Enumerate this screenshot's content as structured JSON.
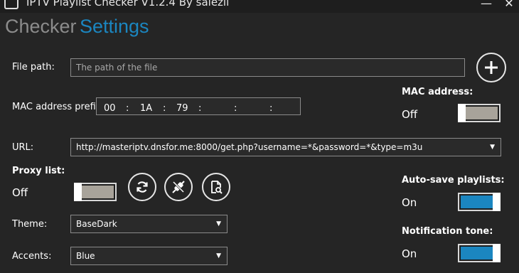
{
  "window": {
    "title": "IPTV Playlist Checker V1.2.4 By salezil",
    "minimize_glyph": "—",
    "close_glyph": "✕"
  },
  "nav": {
    "checker": "Checker",
    "settings": "Settings"
  },
  "colors": {
    "accent": "#1b86c0",
    "toggle_off_fill": "#a8a39a",
    "background": "#252525"
  },
  "file": {
    "label": "File path:",
    "placeholder": "The path of the file",
    "add_icon": "plus-circle-icon"
  },
  "mac_prefix": {
    "label": "MAC address prefix:",
    "segments": [
      "00",
      "1A",
      "79",
      "",
      "",
      ""
    ]
  },
  "mac_address": {
    "label": "MAC address:",
    "state": "Off",
    "on": false
  },
  "url": {
    "label": "URL:",
    "value": "http://masteriptv.dnsfor.me:8000/get.php?username=*&password=*&type=m3u"
  },
  "proxy": {
    "label": "Proxy list:",
    "state": "Off",
    "on": false,
    "buttons": [
      "refresh-icon",
      "unplug-icon",
      "file-search-icon"
    ]
  },
  "autosave": {
    "label": "Auto-save playlists:",
    "state": "On",
    "on": true
  },
  "notification": {
    "label": "Notification tone:",
    "state": "On",
    "on": true
  },
  "theme": {
    "label": "Theme:",
    "value": "BaseDark"
  },
  "accents": {
    "label": "Accents:",
    "value": "Blue"
  }
}
